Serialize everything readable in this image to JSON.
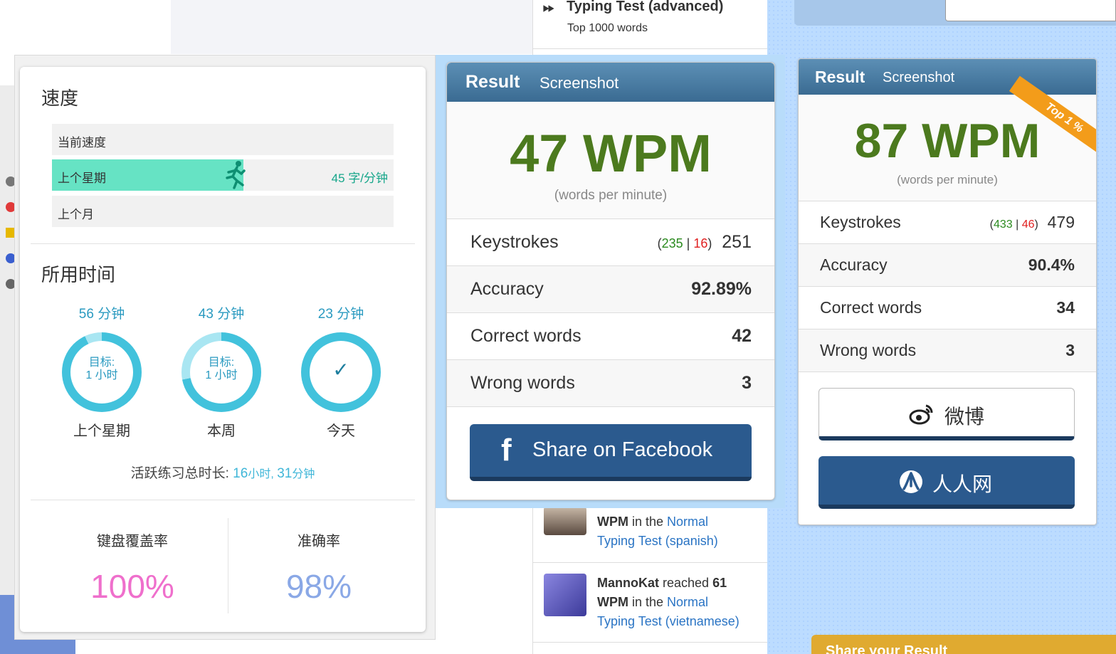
{
  "colors": {
    "accent_teal": "#66e3c4",
    "wpm_green": "#4c7a1e",
    "facebook_blue": "#2b5a8e",
    "coverage_pink": "#ef6fcc",
    "accuracy_blue": "#8aa8e6",
    "ring_cyan": "#42c2dc"
  },
  "feed": {
    "top_title": "Typing Test (advanced)",
    "top_sub": "Top 1000 words",
    "item1": {
      "bold": "WPM",
      "mid": " in the ",
      "link1": "Normal",
      "link2": "Typing Test (spanish)"
    },
    "item2": {
      "user": "MannoKat",
      "mid1": " reached ",
      "wpm": "61",
      "bold": "WPM",
      "mid": " in the ",
      "link1": "Normal",
      "link2": "Typing Test (vietnamese)"
    }
  },
  "stats": {
    "speed_title": "速度",
    "speed_rows": [
      {
        "label": "当前速度",
        "value": "",
        "fill": 0
      },
      {
        "label": "上个星期",
        "value": "45 字/分钟",
        "fill": 0.56
      },
      {
        "label": "上个月",
        "value": "",
        "fill": 0
      }
    ],
    "time_title": "所用时间",
    "rings": [
      {
        "minutes": "56 分钟",
        "goal1": "目标:",
        "goal2": "1 小时",
        "caption": "上个星期",
        "progress": 0.93
      },
      {
        "minutes": "43 分钟",
        "goal1": "目标:",
        "goal2": "1 小时",
        "caption": "本周",
        "progress": 0.72
      },
      {
        "minutes": "23 分钟",
        "check": "✓",
        "caption": "今天",
        "progress": 1.0
      }
    ],
    "total_label": "活跃练习总时长: ",
    "total_h": "16",
    "total_h_unit": "小时, ",
    "total_m": "31",
    "total_m_unit": "分钟",
    "coverage_label": "键盘覆盖率",
    "coverage_value": "100%",
    "accuracy_label": "准确率",
    "accuracy_value": "98%"
  },
  "result1": {
    "tab_result": "Result",
    "tab_screenshot": "Screenshot",
    "wpm": "47 WPM",
    "wpm_sub": "(words per minute)",
    "keystrokes_label": "Keystrokes",
    "keystrokes_correct": "235",
    "keystrokes_wrong": "16",
    "keystrokes_total": "251",
    "accuracy_label": "Accuracy",
    "accuracy_value": "92.89%",
    "correct_label": "Correct words",
    "correct_value": "42",
    "wrong_label": "Wrong words",
    "wrong_value": "3",
    "share_fb": "Share on Facebook"
  },
  "result2": {
    "tab_result": "Result",
    "tab_screenshot": "Screenshot",
    "ribbon": "Top 1 %",
    "wpm": "87 WPM",
    "wpm_sub": "(words per minute)",
    "keystrokes_label": "Keystrokes",
    "keystrokes_correct": "433",
    "keystrokes_wrong": "46",
    "keystrokes_total": "479",
    "accuracy_label": "Accuracy",
    "accuracy_value": "90.4%",
    "correct_label": "Correct words",
    "correct_value": "34",
    "wrong_label": "Wrong words",
    "wrong_value": "3",
    "weibo": "微博",
    "renren": "人人网"
  },
  "bottom_banner": "Share your Result"
}
